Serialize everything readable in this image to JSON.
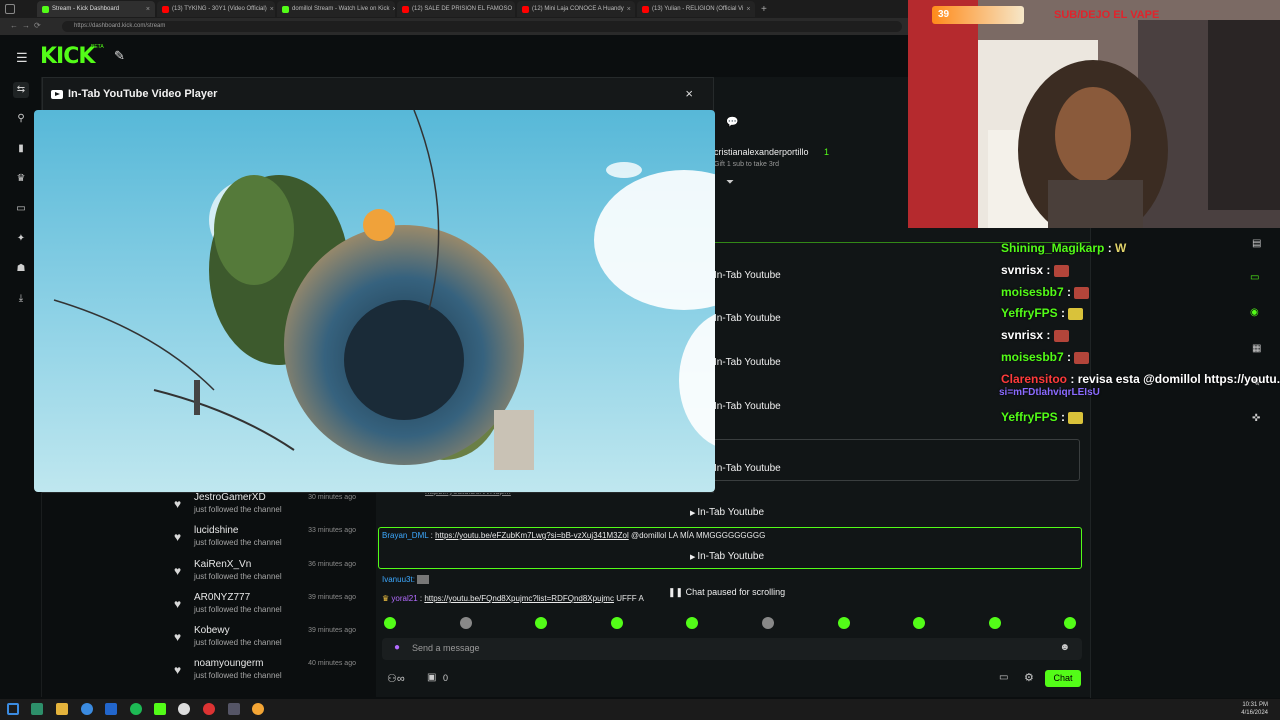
{
  "browser": {
    "tabs": [
      {
        "label": "Stream - Kick Dashboard",
        "color": "#53fc18",
        "active": true
      },
      {
        "label": "(13) TYKING - 30Y1 (Video Official)",
        "color": "#ff0000"
      },
      {
        "label": "domillol Stream - Watch Live on Kick",
        "color": "#53fc18"
      },
      {
        "label": "(12) SALE DE PRISION EL FAMOSO",
        "color": "#ff0000"
      },
      {
        "label": "(12) Mini Laja CONOCE A Huandy",
        "color": "#ff0000"
      },
      {
        "label": "(13) Yulian - RELIGION (Official Vi",
        "color": "#ff0000"
      }
    ],
    "url": "https://dashboard.kick.com/stream"
  },
  "kick": {
    "logo": "KICK",
    "beta": "BETA"
  },
  "player": {
    "title": "In-Tab YouTube Video Player",
    "close": "×"
  },
  "followers": [
    {
      "name": "JestroGamerXD",
      "sub": "just followed the channel",
      "time": "30 minutes ago"
    },
    {
      "name": "lucidshine",
      "sub": "just followed the channel",
      "time": "33 minutes ago"
    },
    {
      "name": "KaiRenX_Vn",
      "sub": "just followed the channel",
      "time": "36 minutes ago"
    },
    {
      "name": "AR0NYZ777",
      "sub": "just followed the channel",
      "time": "39 minutes ago"
    },
    {
      "name": "Kobewy",
      "sub": "just followed the channel",
      "time": "39 minutes ago"
    },
    {
      "name": "noamyoungerm",
      "sub": "just followed the channel",
      "time": "40 minutes ago"
    }
  ],
  "chat": {
    "gift_user": "cristianalexanderportillo",
    "gift_count": "1",
    "gift_sub": "Gift 1 sub to take 3rd",
    "in_tab_label": "In-Tab Youtube",
    "link_line_1": "https://youtu.be/vvKup...",
    "brayan_user": "Brayan_DML",
    "brayan_link": "https://youtu.be/eFZubKm7Lwg?si=bB-vzXuj341M3Zol",
    "brayan_text": "@domillol LA MÍA MMGGGGGGGGG",
    "ivanuu_user": "Ivanuu3t:",
    "yoral_user": "yoral21",
    "yoral_link": "https://youtu.be/FQnd8Xpujmc?list=RDFQnd8Xpujmc",
    "yoral_text": "UFFF A",
    "paused": "Chat paused for scrolling",
    "placeholder": "Send a message",
    "count": "0",
    "chat_button": "Chat"
  },
  "webcam": {
    "badge": "39",
    "banner": "SUB/DEJO EL VAPE"
  },
  "overlay_chat": [
    {
      "user": "Shining_Magikarp",
      "color": "#53fc18",
      "text": "W"
    },
    {
      "user": "svnrisx",
      "color": "#ffffff",
      "text": ""
    },
    {
      "user": "moisesbb7",
      "color": "#53fc18",
      "text": ""
    },
    {
      "user": "YeffryFPS",
      "color": "#53fc18",
      "text": ""
    },
    {
      "user": "svnrisx",
      "color": "#ffffff",
      "text": ""
    },
    {
      "user": "moisesbb7",
      "color": "#53fc18",
      "text": ""
    },
    {
      "user": "Clarensitoo",
      "color": "#ff3b3b",
      "text": "revisa esta @domillol https://youtu.be/",
      "text2": "si=mFDtlahviqrLEIsU"
    },
    {
      "user": "YeffryFPS",
      "color": "#53fc18",
      "text": ""
    }
  ],
  "clock": {
    "time": "10:31 PM",
    "date": "4/16/2024"
  }
}
